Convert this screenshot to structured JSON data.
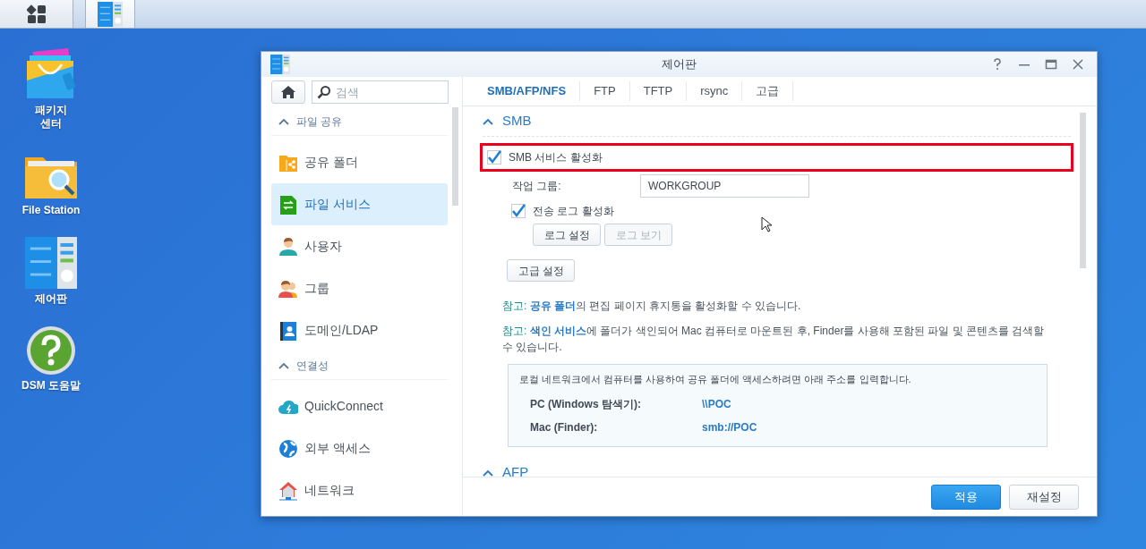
{
  "taskbar": {
    "buttons": [
      {
        "kind": "main-menu",
        "selected": false
      },
      {
        "kind": "control-panel",
        "selected": true
      }
    ]
  },
  "desktop_icons": [
    {
      "kind": "package",
      "label": "패키지\n센터"
    },
    {
      "kind": "folder-search",
      "label": "File Station"
    },
    {
      "kind": "control-panel",
      "label": "제어판"
    },
    {
      "kind": "help",
      "label": "DSM 도움말"
    }
  ],
  "window": {
    "title": "제어판",
    "sidebar": {
      "search": {
        "placeholder": "검색"
      },
      "sections": [
        {
          "title": "파일 공유",
          "expanded": true,
          "items": [
            {
              "label": "공유 폴더",
              "selected": false
            },
            {
              "label": "파일 서비스",
              "selected": true
            },
            {
              "label": "사용자",
              "selected": false
            },
            {
              "label": "그룹",
              "selected": false
            },
            {
              "label": "도메인/LDAP",
              "selected": false
            }
          ]
        },
        {
          "title": "연결성",
          "expanded": true,
          "items": [
            {
              "label": "QuickConnect",
              "selected": false
            },
            {
              "label": "외부 액세스",
              "selected": false
            },
            {
              "label": "네트워크",
              "selected": false
            }
          ]
        }
      ]
    },
    "tabs": [
      {
        "label": "SMB/AFP/NFS",
        "selected": true
      },
      {
        "label": "FTP",
        "selected": false
      },
      {
        "label": "TFTP",
        "selected": false
      },
      {
        "label": "rsync",
        "selected": false
      },
      {
        "label": "고급",
        "selected": false
      }
    ],
    "smb": {
      "title": "SMB",
      "expanded": true,
      "enable": {
        "label": "SMB 서비스 활성화",
        "checked": true,
        "highlighted": true
      },
      "workgroup": {
        "label": "작업 그룹:",
        "value": "WORKGROUP"
      },
      "transfer_log": {
        "label": "전송 로그 활성화",
        "checked": true
      },
      "log_buttons": [
        {
          "label": "로그 설정",
          "disabled": false
        },
        {
          "label": "로그 보기",
          "disabled": true
        }
      ],
      "advanced_button": {
        "label": "고급 설정"
      },
      "notes": [
        {
          "prefix": "참고:",
          "link": "공유 폴더",
          "text": "의 편집 페이지 휴지통을 활성화할 수 있습니다."
        },
        {
          "prefix": "참고:",
          "link": "색인 서비스",
          "text": "에 폴더가 색인되어 Mac 컴퓨터로 마운트된 후, Finder를 사용해 포함된 파일 및 콘텐츠를 검색할 수 있습니다."
        }
      ],
      "info": {
        "text": "로컬 네트워크에서 컴퓨터를 사용하여 공유 폴더에 액세스하려면 아래 주소를 입력합니다.",
        "rows": [
          {
            "label": "PC (Windows 탐색기):",
            "value": "\\\\POC"
          },
          {
            "label": "Mac (Finder):",
            "value": "smb://POC"
          }
        ]
      }
    },
    "afp": {
      "title": "AFP",
      "expanded": true
    },
    "footer_buttons": [
      {
        "label": "적용",
        "kind": "primary"
      },
      {
        "label": "재설정",
        "kind": "secondary"
      }
    ]
  }
}
